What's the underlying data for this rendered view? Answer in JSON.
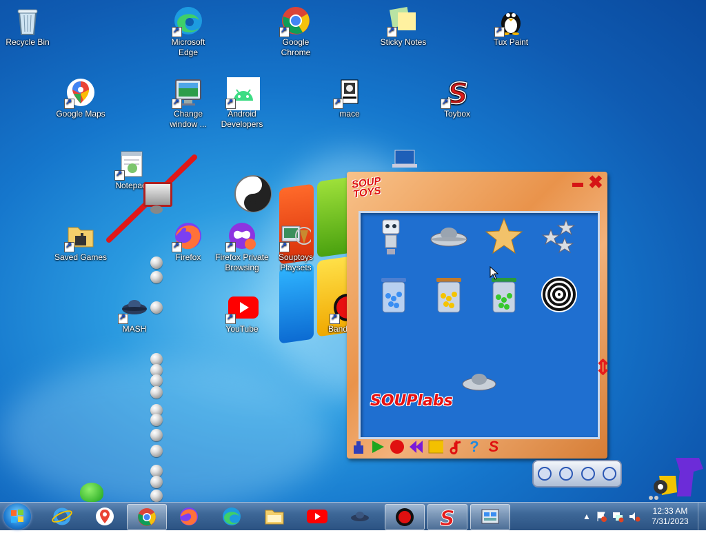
{
  "desktop_icons": {
    "recycle_bin": "Recycle Bin",
    "edge": "Microsoft Edge",
    "chrome": "Google Chrome",
    "sticky_notes": "Sticky Notes",
    "tux_paint": "Tux Paint",
    "google_maps": "Google Maps",
    "change_window": "Change window ...",
    "android_dev": "Android Developers",
    "mace": "mace",
    "toybox": "Toybox",
    "notepad": "Notepad",
    "saved_games": "Saved Games",
    "firefox": "Firefox",
    "firefox_private": "Firefox Private Browsing",
    "souptoys_playsets": "Souptoys Playsets",
    "mash": "MASH",
    "youtube": "YouTube",
    "band": "Band"
  },
  "soup_window": {
    "logo": "SOUP TOYS",
    "brand": "SOUPlabs",
    "minimize": "minimize",
    "close": "✖",
    "toolbar": [
      "tool",
      "play",
      "record",
      "rewind",
      "stop",
      "music",
      "help",
      "souptoys"
    ]
  },
  "taskbar": {
    "pinned": [
      "Internet Explorer",
      "Google Maps",
      "Google Chrome",
      "Firefox",
      "Microsoft Edge",
      "File Explorer",
      "YouTube",
      "MASH",
      "Recorder",
      "Toybox",
      "Control Panel"
    ],
    "time": "12:33 AM",
    "date": "7/31/2023"
  },
  "colors": {
    "accent_red": "#e81010",
    "window_blue": "#1f6fd0",
    "wood": "#e9934b"
  }
}
